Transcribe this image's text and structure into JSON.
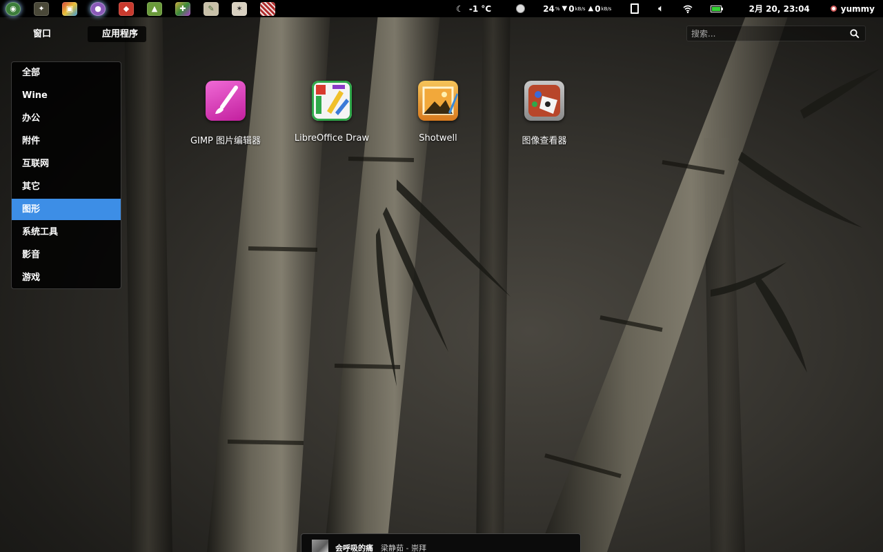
{
  "top_panel": {
    "launchers": [
      {
        "icon": "deepin-logo-icon",
        "color": "#3c7d3a"
      },
      {
        "icon": "scanner-icon",
        "color": "#3a3a2e"
      },
      {
        "icon": "photo-tool-icon",
        "color": "#b48a3a"
      },
      {
        "icon": "chat-bubble-icon",
        "color": "#8a5ab8"
      },
      {
        "icon": "angry-birds-icon",
        "color": "#c83a2e"
      },
      {
        "icon": "android-tool-icon",
        "color": "#6a9a3a"
      },
      {
        "icon": "pinwheel-icon",
        "color": "#5a8a3a"
      },
      {
        "icon": "script-icon",
        "color": "#c8c0a8"
      },
      {
        "icon": "martial-arts-game-icon",
        "color": "#d8d0c0"
      },
      {
        "icon": "zebra-icon",
        "color": "#b02a2a"
      }
    ],
    "weather": "-1 °C",
    "cpu_percent": "24",
    "cpu_unit": "%",
    "net_down_value": "0",
    "net_up_value": "0",
    "net_unit": "kB/s",
    "datetime": "2月 20, 23:04",
    "username": "yummy"
  },
  "view_tabs": {
    "windows": "窗口",
    "applications": "应用程序"
  },
  "search": {
    "placeholder": "搜索..."
  },
  "categories": [
    "全部",
    "Wine",
    "办公",
    "附件",
    "互联网",
    "其它",
    "图形",
    "系统工具",
    "影音",
    "游戏"
  ],
  "selected_category": "图形",
  "selected_color": "#3d8ee6",
  "apps": [
    {
      "label": "GIMP 图片编辑器",
      "icon": "gimp-brush-icon"
    },
    {
      "label": "LibreOffice Draw",
      "icon": "libreoffice-draw-icon"
    },
    {
      "label": "Shotwell",
      "icon": "shotwell-photo-icon"
    },
    {
      "label": "图像查看器",
      "icon": "image-viewer-icon"
    }
  ],
  "music": {
    "title": "会呼吸的痛",
    "artist_album": "梁静茹 - 崇拜"
  }
}
